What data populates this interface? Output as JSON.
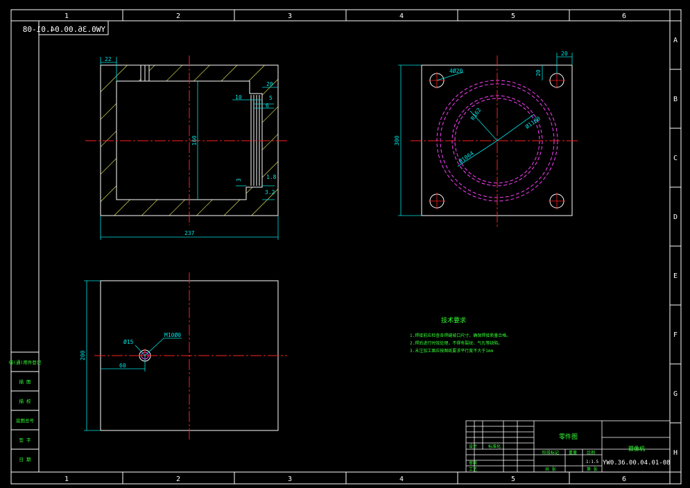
{
  "colors": {
    "frame": "#ffffff",
    "grid_text": "#ffffff",
    "dim": "#00e5e5",
    "center": "#ff2020",
    "hatch": "#ffff66",
    "hidden": "#ff40ff",
    "text_green": "#33ff33",
    "title_text": "#33ff33"
  },
  "border": {
    "columns": [
      "1",
      "2",
      "3",
      "4",
      "5",
      "6"
    ],
    "rows": [
      "A",
      "B",
      "C",
      "D",
      "E",
      "F",
      "G",
      "H"
    ],
    "mirrored_code": "YW0.36.00.04.01-08"
  },
  "views": {
    "section": {
      "dims": {
        "top_left": "22",
        "height": "160",
        "width": "237",
        "right_top": "20",
        "r10": "10",
        "r5": "5",
        "r6": "6",
        "r3": "3",
        "r18": "1.8",
        "r32": "3.2"
      }
    },
    "plan": {
      "dims": {
        "corner_x": "20",
        "corner_y": "20",
        "hole": "4Ø20",
        "height": "300",
        "r162": "R162",
        "d1": "Ø1180",
        "d2": "Ø1064"
      }
    },
    "bottom": {
      "dims": {
        "height": "200",
        "offset": "60",
        "hole": "Ø15",
        "thread": "M10Ø0"
      }
    }
  },
  "notes": {
    "title": "技术要求",
    "lines": [
      "1.焊接前应检查各焊缝坡口尺寸，确保焊接质量合格。",
      "2.焊后进行时效处理，不得有裂纹、气孔等缺陷。",
      "3.未注加工面应按图纸要求平行度不大于1mm"
    ]
  },
  "left_panel": {
    "items": [
      "借(通)用件登记",
      "描 图",
      "描 校",
      "底图总号",
      "签 字",
      "日 期"
    ]
  },
  "title_block": {
    "part_name": "零件图",
    "company": "摄像机",
    "code": "YW0.36.00.04.01-08",
    "scale": "1:1.5",
    "sig_labels": [
      "设计",
      "审核",
      "工艺",
      "标准化"
    ],
    "header_labels": [
      "阶段标记",
      "重量",
      "比例"
    ],
    "footer_labels": [
      "共 张",
      "第 张"
    ]
  }
}
